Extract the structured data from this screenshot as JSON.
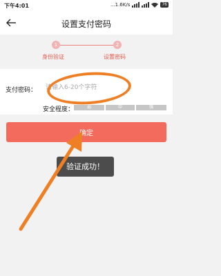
{
  "status_bar": {
    "time": "下午4:01",
    "network_speed": "...1.6K/s",
    "battery": "76"
  },
  "header": {
    "title": "设置支付密码",
    "back_icon": "arrow-left-icon"
  },
  "steps": [
    {
      "number": "1",
      "label": "身份验证"
    },
    {
      "number": "2",
      "label": "设置密码"
    }
  ],
  "form": {
    "password_label": "支付密码：",
    "password_placeholder": "请输入6-20个字符",
    "password_value": "",
    "strength_label": "安全程度：",
    "strength_levels": [
      "弱",
      "中",
      "强"
    ]
  },
  "confirm_button": {
    "label": "确定"
  },
  "toast": {
    "text": "验证成功！"
  },
  "colors": {
    "accent": "#f36b5d",
    "step_text": "#e65b4b",
    "annotation": "#ee7f24",
    "toast_bg": "#4c4c4c"
  }
}
